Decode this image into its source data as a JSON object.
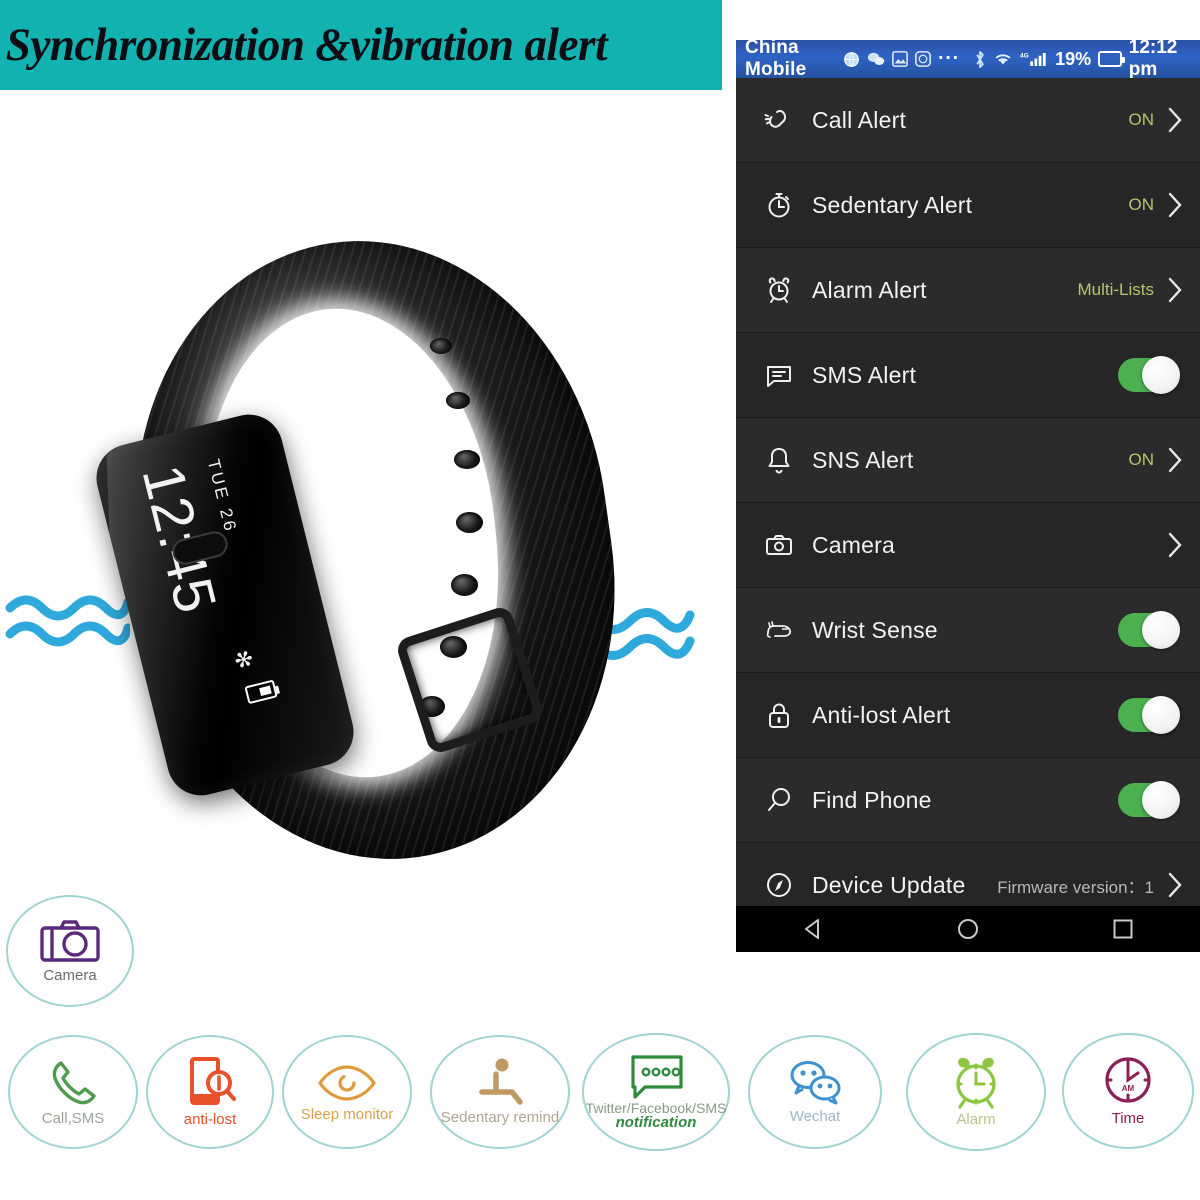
{
  "banner": {
    "title": "Synchronization &vibration alert"
  },
  "watch": {
    "screen": {
      "date": "TUE 26",
      "time": "12:45",
      "bluetooth_icon": "bluetooth-icon",
      "battery_icon": "battery-icon"
    }
  },
  "vibration": {
    "left_icon": "vibration-waves-icon",
    "right_icon": "vibration-waves-icon"
  },
  "phone": {
    "statusbar": {
      "carrier": "China Mobile",
      "icons": [
        "browser-icon",
        "wechat-icon",
        "gallery-icon",
        "app-icon",
        "more-icon",
        "bluetooth-icon",
        "wifi-icon",
        "signal-icon"
      ],
      "network": "4G",
      "battery_percent": "19%",
      "time": "12:12 pm"
    },
    "settings": [
      {
        "icon": "ringing-phone-icon",
        "label": "Call Alert",
        "value": "ON",
        "control": "chevron"
      },
      {
        "icon": "stopwatch-icon",
        "label": "Sedentary Alert",
        "value": "ON",
        "control": "chevron"
      },
      {
        "icon": "alarm-clock-icon",
        "label": "Alarm Alert",
        "value": "Multi-Lists",
        "control": "chevron"
      },
      {
        "icon": "message-icon",
        "label": "SMS Alert",
        "value": "",
        "control": "toggle-on"
      },
      {
        "icon": "bell-icon",
        "label": "SNS Alert",
        "value": "ON",
        "control": "chevron"
      },
      {
        "icon": "camera-icon",
        "label": "Camera",
        "value": "",
        "control": "chevron"
      },
      {
        "icon": "wrist-hand-icon",
        "label": "Wrist Sense",
        "value": "",
        "control": "toggle-on"
      },
      {
        "icon": "lock-icon",
        "label": "Anti-lost Alert",
        "value": "",
        "control": "toggle-on"
      },
      {
        "icon": "magnifier-icon",
        "label": "Find Phone",
        "value": "",
        "control": "toggle-on"
      },
      {
        "icon": "compass-icon",
        "label": "Device Update",
        "value": "Firmware version：1",
        "control": "chevron"
      }
    ],
    "navbar": [
      {
        "icon": "back-triangle-icon"
      },
      {
        "icon": "home-circle-icon"
      },
      {
        "icon": "recents-square-icon"
      }
    ]
  },
  "features": [
    {
      "icon": "camera-icon",
      "label": "Camera",
      "label2": "",
      "color": "#5b2a7e"
    },
    {
      "icon": "phone-handset-icon",
      "label": "Call,SMS",
      "label2": "",
      "color": "#4d9b4d"
    },
    {
      "icon": "phone-search-icon",
      "label": "anti-lost",
      "label2": "",
      "color": "#e8512a"
    },
    {
      "icon": "sleep-eye-icon",
      "label": "Sleep monitor",
      "label2": "",
      "color": "#e09a3c"
    },
    {
      "icon": "sitting-person-icon",
      "label": "Sedentary remind",
      "label2": "",
      "color": "#c09a63"
    },
    {
      "icon": "chat-bubble-icon",
      "label": "Twitter/Facebook/SMS",
      "label2": "notification",
      "color": "#2e8b3d"
    },
    {
      "icon": "wechat-bubbles-icon",
      "label": "Wechat",
      "label2": "",
      "color": "#3d91d1"
    },
    {
      "icon": "alarm-clock-icon",
      "label": "Alarm",
      "label2": "",
      "color": "#8cc63e"
    },
    {
      "icon": "clock-am-icon",
      "label": "Time",
      "label2": "",
      "color": "#8e1f52"
    }
  ],
  "colors": {
    "banner_teal": "#12b2b0",
    "toggle_green": "#4caf50",
    "value_green": "#b6c46a",
    "bubble_border": "#9fd4d2",
    "wave_blue": "#2fa8dc",
    "statusbar_blue": "#2f63c4"
  }
}
